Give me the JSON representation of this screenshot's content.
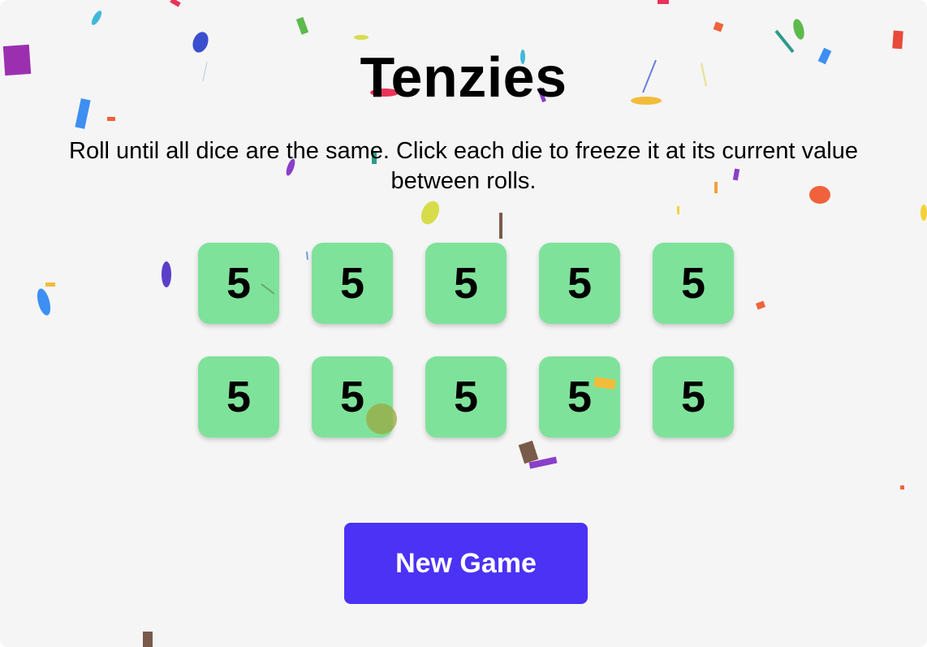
{
  "game": {
    "title": "Tenzies",
    "instructions": "Roll until all dice are the same. Click each die to freeze it at its current value between rolls.",
    "dice": [
      {
        "value": "5",
        "held": true
      },
      {
        "value": "5",
        "held": true
      },
      {
        "value": "5",
        "held": true
      },
      {
        "value": "5",
        "held": true
      },
      {
        "value": "5",
        "held": true
      },
      {
        "value": "5",
        "held": true
      },
      {
        "value": "5",
        "held": true
      },
      {
        "value": "5",
        "held": true
      },
      {
        "value": "5",
        "held": true
      },
      {
        "value": "5",
        "held": true
      }
    ],
    "button_label": "New Game",
    "won": true
  },
  "colors": {
    "background": "#f5f5f5",
    "held_die": "#7fe29a",
    "button": "#4b32f5",
    "button_text": "#ffffff"
  }
}
